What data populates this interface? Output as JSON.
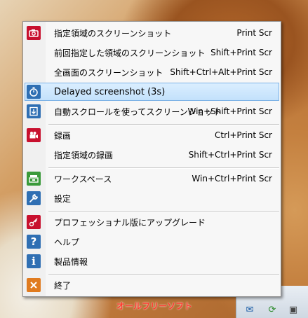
{
  "menu": {
    "items": [
      {
        "label": "指定領域のスクリーンショット",
        "shortcut": "Print Scr",
        "icon": "camera-icon"
      },
      {
        "label": "前回指定した領域のスクリーンショット",
        "shortcut": "Shift+Print Scr",
        "icon": ""
      },
      {
        "label": "全画面のスクリーンショット",
        "shortcut": "Shift+Ctrl+Alt+Print Scr",
        "icon": ""
      },
      {
        "label": "Delayed screenshot (3s)",
        "shortcut": "",
        "icon": "timer-icon"
      },
      {
        "label": "自動スクロールを使ってスクリーンショット",
        "shortcut": "Win+Shift+Print Scr",
        "icon": "scroll-capture-icon"
      },
      {
        "label": "録画",
        "shortcut": "Ctrl+Print Scr",
        "icon": "video-camera-icon"
      },
      {
        "label": "指定領域の録画",
        "shortcut": "Shift+Ctrl+Print Scr",
        "icon": ""
      },
      {
        "label": "ワークスペース",
        "shortcut": "Win+Ctrl+Print Scr",
        "icon": "workspace-icon"
      },
      {
        "label": "設定",
        "shortcut": "",
        "icon": "wrench-icon"
      },
      {
        "label": "プロフェッショナル版にアップグレード",
        "shortcut": "",
        "icon": "key-icon"
      },
      {
        "label": "ヘルプ",
        "shortcut": "",
        "icon": "help-icon"
      },
      {
        "label": "製品情報",
        "shortcut": "",
        "icon": "info-icon"
      },
      {
        "label": "終了",
        "shortcut": "",
        "icon": "exit-icon"
      }
    ]
  },
  "colors": {
    "red_icon": "#c8102e",
    "blue_icon": "#2f6fb3",
    "green_icon": "#3a9a3a",
    "orange_icon": "#e07b1f",
    "highlight": "#c3e1fb"
  },
  "desktop": {
    "wallpaper_text": "オールフリーソフト"
  }
}
